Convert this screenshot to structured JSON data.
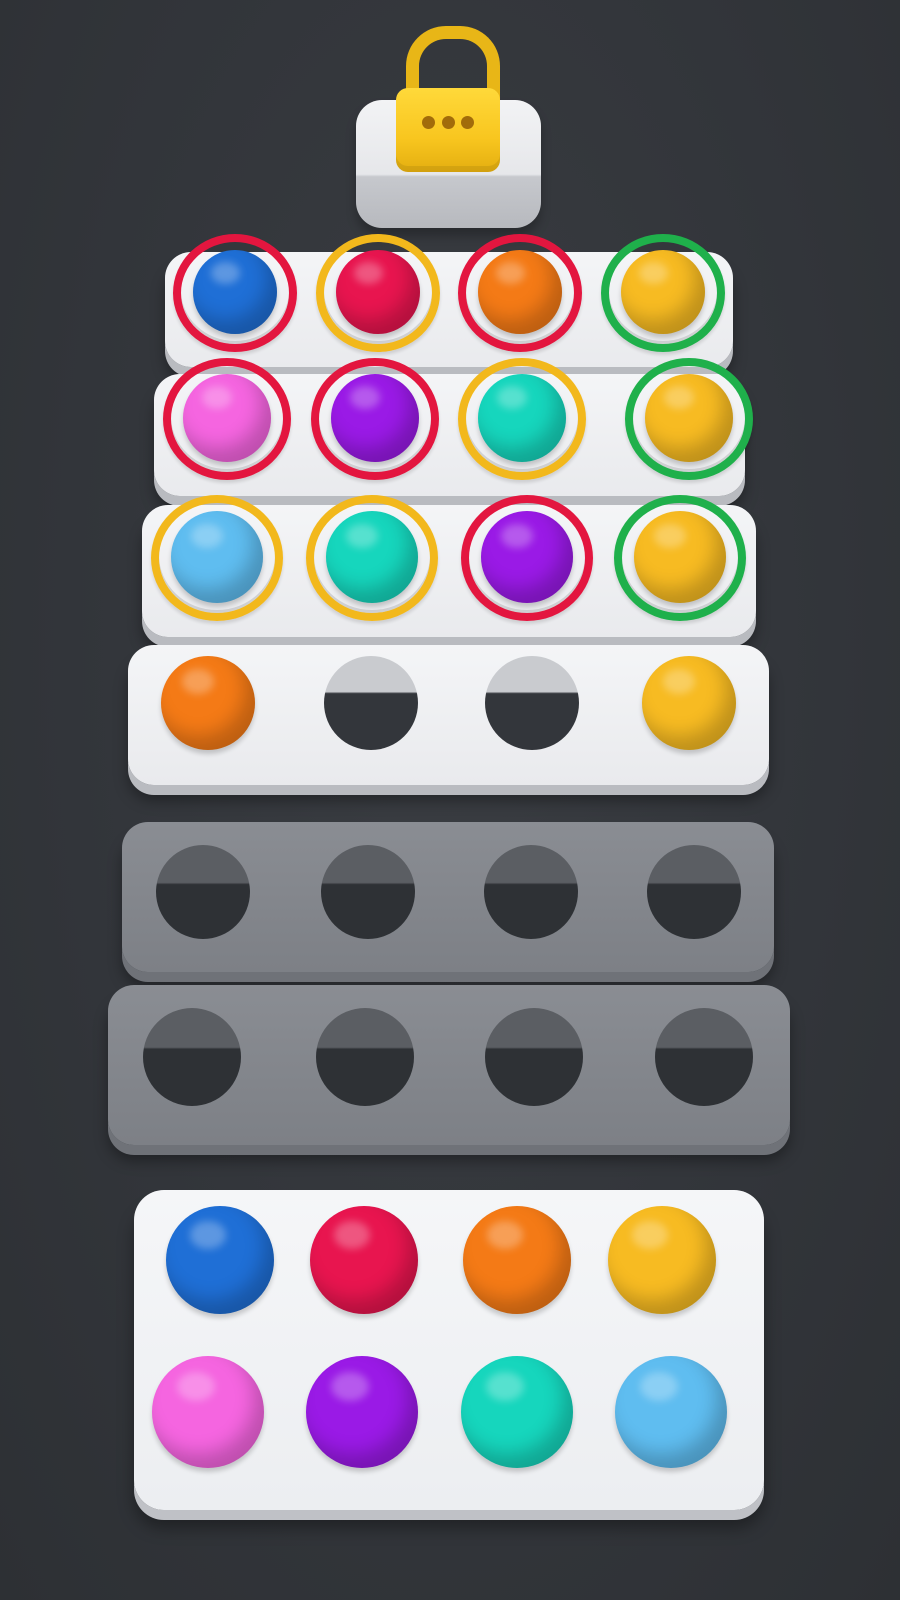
{
  "colors": {
    "blue": "#1f6fd6",
    "red": "#e8154f",
    "orange": "#f47a16",
    "yellow": "#f7bb22",
    "pink": "#f565e0",
    "purple": "#9a1ae6",
    "teal": "#16d6bd",
    "sky": "#5fbdf0",
    "ring_red": "#e3163f",
    "ring_yellow": "#f2b81c",
    "ring_green": "#1fb04b"
  },
  "lock": {
    "icon": "padlock-icon",
    "state": "locked"
  },
  "rows": [
    {
      "tray": "white",
      "slots": [
        {
          "ball": "blue",
          "ring": "ring_red"
        },
        {
          "ball": "red",
          "ring": "ring_yellow"
        },
        {
          "ball": "orange",
          "ring": "ring_red"
        },
        {
          "ball": "yellow",
          "ring": "ring_green"
        }
      ]
    },
    {
      "tray": "white",
      "slots": [
        {
          "ball": "pink",
          "ring": "ring_red"
        },
        {
          "ball": "purple",
          "ring": "ring_red"
        },
        {
          "ball": "teal",
          "ring": "ring_yellow"
        },
        {
          "ball": "yellow",
          "ring": "ring_green"
        }
      ]
    },
    {
      "tray": "white",
      "slots": [
        {
          "ball": "sky",
          "ring": "ring_yellow"
        },
        {
          "ball": "teal",
          "ring": "ring_yellow"
        },
        {
          "ball": "purple",
          "ring": "ring_red"
        },
        {
          "ball": "yellow",
          "ring": "ring_green"
        }
      ]
    },
    {
      "tray": "white",
      "slots": [
        {
          "ball": "orange",
          "ring": null
        },
        {
          "ball": null,
          "ring": null
        },
        {
          "ball": null,
          "ring": null
        },
        {
          "ball": "yellow",
          "ring": null
        }
      ]
    },
    {
      "tray": "grey",
      "slots": [
        {
          "ball": null,
          "ring": null
        },
        {
          "ball": null,
          "ring": null
        },
        {
          "ball": null,
          "ring": null
        },
        {
          "ball": null,
          "ring": null
        }
      ]
    },
    {
      "tray": "grey",
      "slots": [
        {
          "ball": null,
          "ring": null
        },
        {
          "ball": null,
          "ring": null
        },
        {
          "ball": null,
          "ring": null
        },
        {
          "ball": null,
          "ring": null
        }
      ]
    }
  ],
  "palette": [
    "blue",
    "red",
    "orange",
    "yellow",
    "pink",
    "purple",
    "teal",
    "sky"
  ]
}
